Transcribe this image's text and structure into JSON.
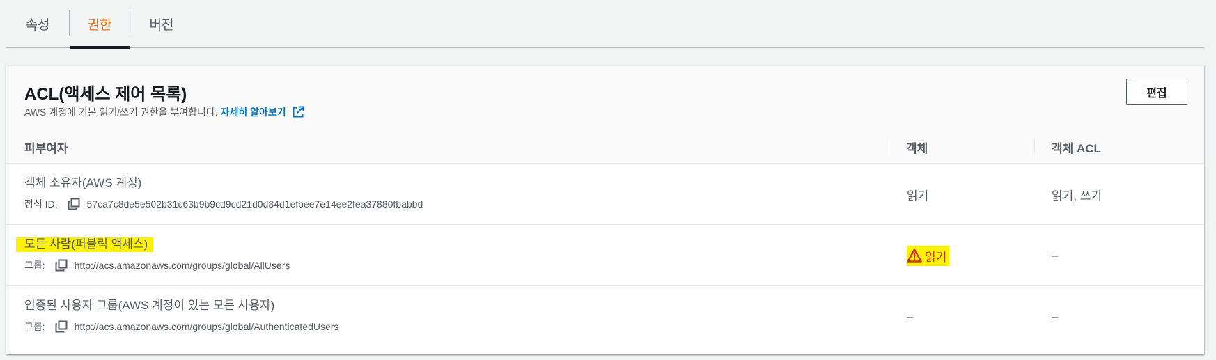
{
  "tabs": [
    {
      "label": "속성"
    },
    {
      "label": "권한"
    },
    {
      "label": "버전"
    }
  ],
  "panel": {
    "title": "ACL(액세스 제어 목록)",
    "description": "AWS 계정에 기본 읽기/쓰기 권한을 부여합니다.",
    "learn_more": "자세히 알아보기",
    "edit_label": "편집"
  },
  "table": {
    "columns": [
      "피부여자",
      "객체",
      "객체 ACL"
    ],
    "rows": [
      {
        "grantee": "객체 소유자(AWS 계정)",
        "sub_label": "정식 ID:",
        "sub_value": "57ca7c8de5e502b31c63b9b9cd9cd21d0d34d1efbee7e14ee2fea37880fbabbd",
        "object": "읽기",
        "object_acl": "읽기, 쓰기"
      },
      {
        "grantee": "모든 사람(퍼블릭 액세스)",
        "sub_label": "그룹:",
        "sub_value": "http://acs.amazonaws.com/groups/global/AllUsers",
        "object": "읽기",
        "object_acl": "–"
      },
      {
        "grantee": "인증된 사용자 그룹(AWS 계정이 있는 모든 사용자)",
        "sub_label": "그룹:",
        "sub_value": "http://acs.amazonaws.com/groups/global/AuthenticatedUsers",
        "object": "–",
        "object_acl": "–"
      }
    ]
  },
  "colors": {
    "active_tab": "#ec7211",
    "link": "#0073bb",
    "highlight": "#fff200",
    "warning": "#d13212"
  },
  "icons": {
    "external_link": "external-link-icon",
    "copy": "copy-icon",
    "warning": "warning-icon"
  }
}
